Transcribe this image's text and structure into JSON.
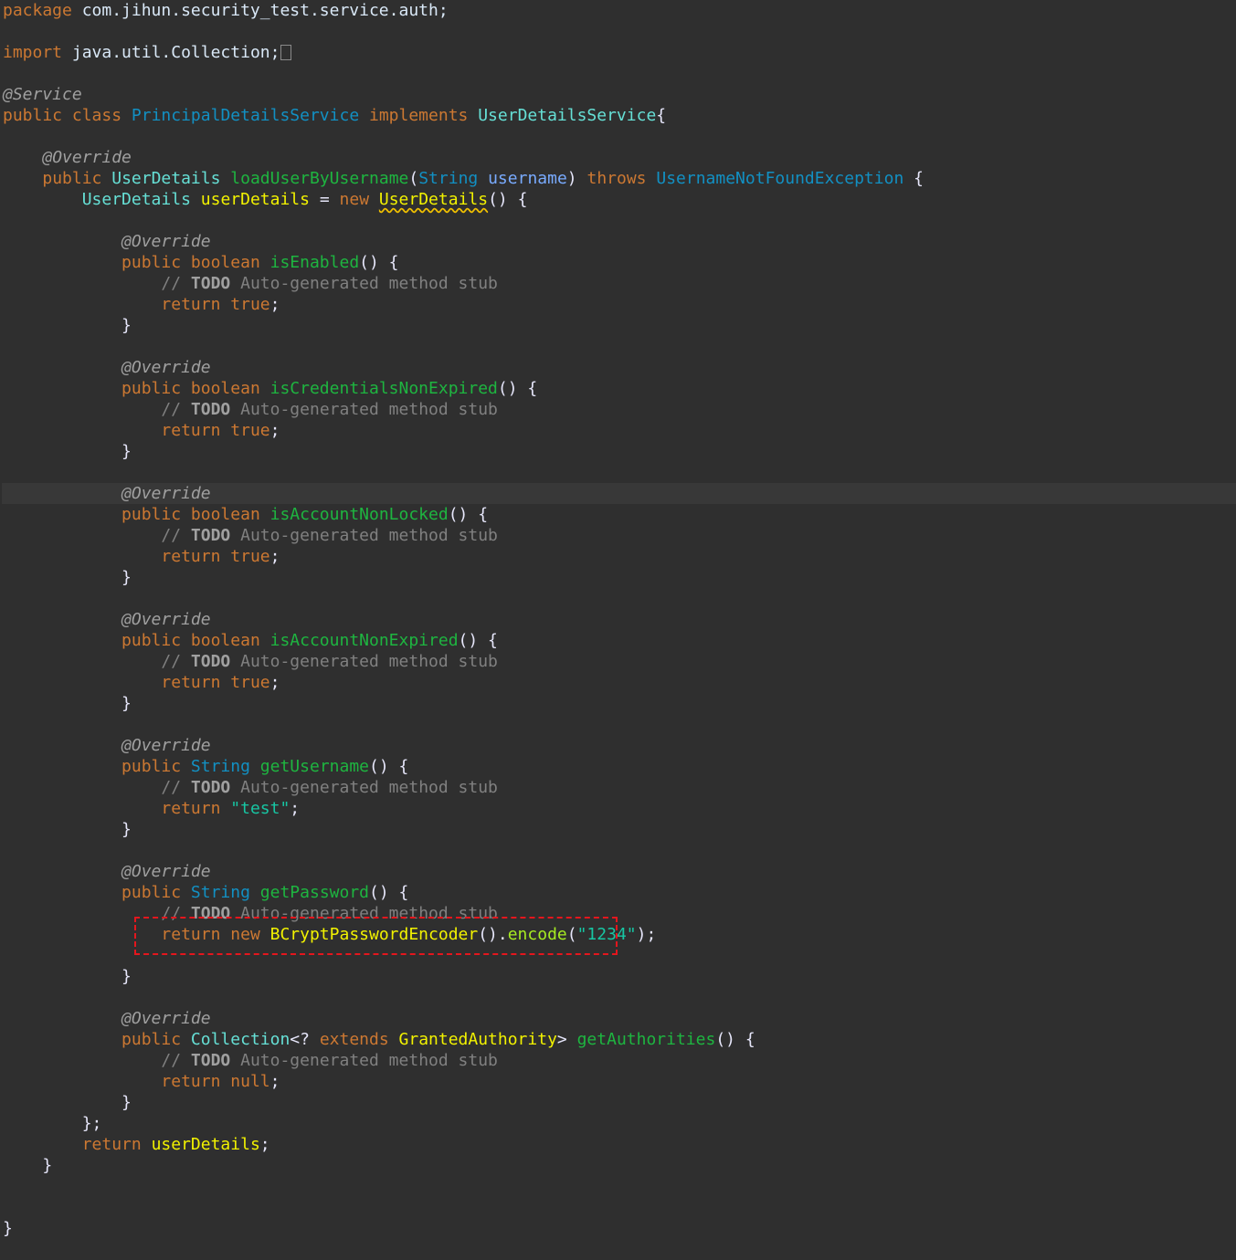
{
  "code": {
    "package_kw": "package",
    "package_name": "com.jihun.security_test.service.auth;",
    "import_kw": "import",
    "import_name": "java.util.Collection;",
    "ann_service": "@Service",
    "kw_public": "public",
    "kw_class": "class",
    "class_name": "PrincipalDetailsService",
    "kw_implements": "implements",
    "iface_name": "UserDetailsService",
    "ann_override": "@Override",
    "type_userdetails": "UserDetails",
    "method_load": "loadUserByUsername",
    "type_string": "String",
    "param_username": "username",
    "kw_throws": "throws",
    "exception_name": "UsernameNotFoundException",
    "var_userdetails": "userDetails",
    "kw_new": "new",
    "kw_boolean": "boolean",
    "method_isEnabled": "isEnabled",
    "method_isCredentialsNonExpired": "isCredentialsNonExpired",
    "method_isAccountNonLocked": "isAccountNonLocked",
    "method_isAccountNonExpired": "isAccountNonExpired",
    "method_getUsername": "getUsername",
    "method_getPassword": "getPassword",
    "method_getAuthorities": "getAuthorities",
    "comment_slashes": "//",
    "todo": "TODO",
    "comment_text": "Auto-generated method stub",
    "kw_return": "return",
    "kw_true": "true",
    "kw_null": "null",
    "str_test": "\"test\"",
    "bcrypt_class": "BCryptPasswordEncoder",
    "encode_method": "encode",
    "str_1234": "\"1234\"",
    "type_collection": "Collection",
    "kw_extends": "extends",
    "type_granted": "GrantedAuthority"
  }
}
